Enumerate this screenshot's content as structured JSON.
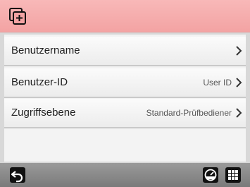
{
  "header": {
    "add_icon": "add-window-icon",
    "accent_color": "#f3a3a3"
  },
  "menu": {
    "items": [
      {
        "label": "Benutzername",
        "value": ""
      },
      {
        "label": "Benutzer-ID",
        "value": "User ID"
      },
      {
        "label": "Zugriffsebene",
        "value": "Standard-Prüfbediener"
      }
    ]
  },
  "footer": {
    "left_icon": "back-icon",
    "right_icons": [
      "gauge-icon",
      "grid-menu-icon"
    ]
  }
}
